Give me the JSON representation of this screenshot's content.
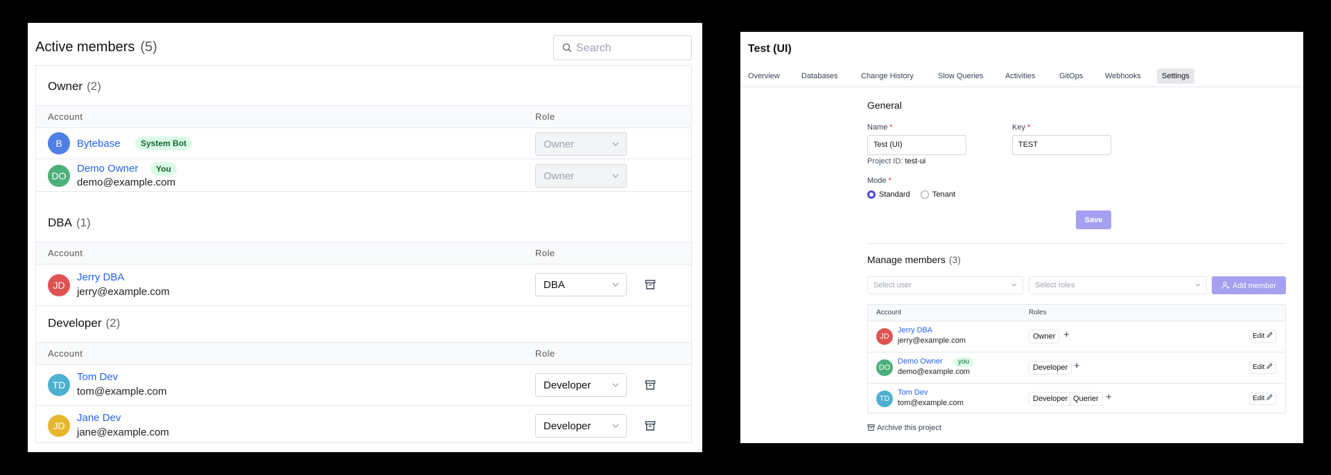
{
  "left": {
    "title": "Active members",
    "count": "(5)",
    "search_placeholder": "Search",
    "groups": [
      {
        "title": "Owner",
        "count": "(2)",
        "col_account": "Account",
        "col_role": "Role",
        "members": [
          {
            "initials": "B",
            "color": "#4f7fe6",
            "name": "Bytebase",
            "badge": "System Bot",
            "email": "",
            "role": "Owner",
            "disabled": true
          },
          {
            "initials": "DO",
            "color": "#4caf7a",
            "name": "Demo Owner",
            "badge": "You",
            "email": "demo@example.com",
            "role": "Owner",
            "disabled": true
          }
        ]
      },
      {
        "title": "DBA",
        "count": "(1)",
        "col_account": "Account",
        "col_role": "Role",
        "members": [
          {
            "initials": "JD",
            "color": "#e05252",
            "name": "Jerry DBA",
            "badge": "",
            "email": "jerry@example.com",
            "role": "DBA",
            "disabled": false
          }
        ]
      },
      {
        "title": "Developer",
        "count": "(2)",
        "col_account": "Account",
        "col_role": "Role",
        "members": [
          {
            "initials": "TD",
            "color": "#4bb0d0",
            "name": "Tom Dev",
            "badge": "",
            "email": "tom@example.com",
            "role": "Developer",
            "disabled": false
          },
          {
            "initials": "JD",
            "color": "#e6b62f",
            "name": "Jane Dev",
            "badge": "",
            "email": "jane@example.com",
            "role": "Developer",
            "disabled": false
          }
        ]
      }
    ]
  },
  "right": {
    "title": "Test (UI)",
    "tabs": [
      "Overview",
      "Databases",
      "Change History",
      "Slow Queries",
      "Activities",
      "GitOps",
      "Webhooks",
      "Settings"
    ],
    "active_tab": "Settings",
    "general": {
      "heading": "General",
      "name_label": "Name",
      "name_value": "Test (UI)",
      "key_label": "Key",
      "key_value": "TEST",
      "project_id_label": "Project ID:",
      "project_id_value": "test-ui",
      "mode_label": "Mode",
      "mode_options": [
        "Standard",
        "Tenant"
      ],
      "mode_selected": "Standard",
      "required_mark": "*",
      "save_label": "Save"
    },
    "members": {
      "heading": "Manage members",
      "count": "(3)",
      "select_user_placeholder": "Select user",
      "select_roles_placeholder": "Select roles",
      "add_label": "Add member",
      "col_account": "Account",
      "col_roles": "Roles",
      "edit_label": "Edit",
      "plus": "+",
      "rows": [
        {
          "initials": "JD",
          "color": "#e05252",
          "name": "Jerry DBA",
          "badge": "",
          "email": "jerry@example.com",
          "roles": [
            "Owner"
          ]
        },
        {
          "initials": "DO",
          "color": "#4caf7a",
          "name": "Demo Owner",
          "badge": "you",
          "email": "demo@example.com",
          "roles": [
            "Developer"
          ]
        },
        {
          "initials": "TD",
          "color": "#4bb0d0",
          "name": "Tom Dev",
          "badge": "",
          "email": "tom@example.com",
          "roles": [
            "Developer",
            "Querier"
          ]
        }
      ]
    },
    "archive_label": "Archive this project"
  }
}
